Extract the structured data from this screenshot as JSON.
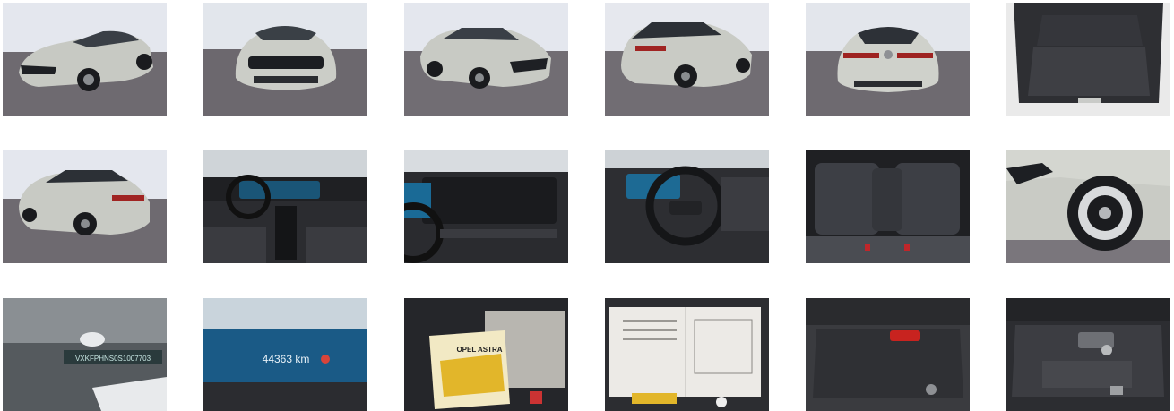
{
  "gallery": {
    "photos": [
      {
        "subject": "car-front-left-three-quarter"
      },
      {
        "subject": "car-front"
      },
      {
        "subject": "car-front-right-three-quarter"
      },
      {
        "subject": "car-rear-left-three-quarter"
      },
      {
        "subject": "car-rear"
      },
      {
        "subject": "trunk-interior"
      },
      {
        "subject": "car-rear-right-three-quarter"
      },
      {
        "subject": "dashboard-cockpit"
      },
      {
        "subject": "dashboard-display"
      },
      {
        "subject": "steering-wheel"
      },
      {
        "subject": "rear-seats"
      },
      {
        "subject": "front-wheel-closeup"
      },
      {
        "subject": "vin-plate",
        "text": "VXKFPHNS0S1007703"
      },
      {
        "subject": "odometer",
        "text": "44363 km"
      },
      {
        "subject": "owner-manual",
        "text": "OPEL ASTRA"
      },
      {
        "subject": "service-booklet"
      },
      {
        "subject": "trunk-tools"
      },
      {
        "subject": "spare-compartment"
      }
    ]
  },
  "colors": {
    "studio_bg": "#dfe3ea",
    "floor": "#6f6b70",
    "car_body": "#c9cbc5",
    "interior_dark": "#2a2c30"
  }
}
